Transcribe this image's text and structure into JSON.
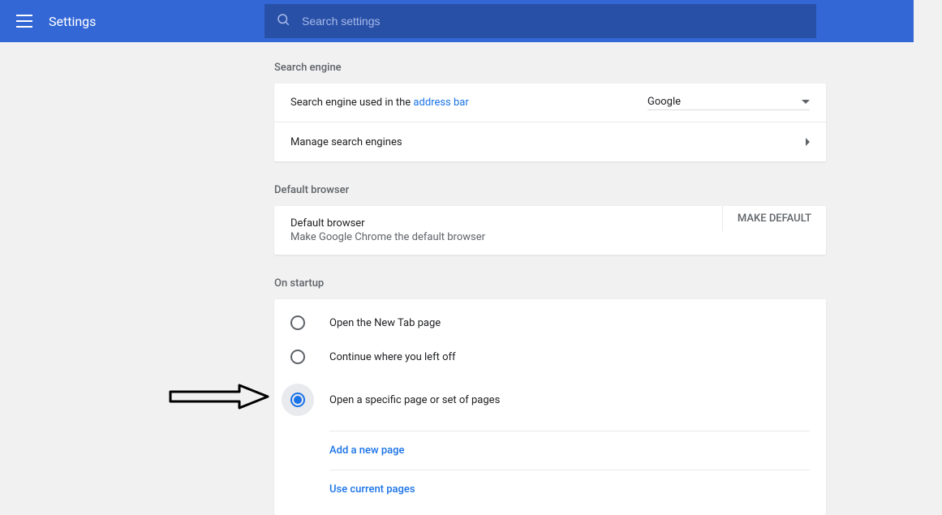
{
  "header": {
    "title": "Settings",
    "search_placeholder": "Search settings"
  },
  "sections": {
    "search_engine": {
      "title": "Search engine",
      "row1_prefix": "Search engine used in the ",
      "row1_link": "address bar",
      "selected_engine": "Google",
      "manage_label": "Manage search engines"
    },
    "default_browser": {
      "title": "Default browser",
      "label": "Default browser",
      "subtext": "Make Google Chrome the default browser",
      "button": "MAKE DEFAULT"
    },
    "on_startup": {
      "title": "On startup",
      "options": [
        "Open the New Tab page",
        "Continue where you left off",
        "Open a specific page or set of pages"
      ],
      "selected_index": 2,
      "sub_links": {
        "add_page": "Add a new page",
        "use_current": "Use current pages"
      }
    }
  }
}
